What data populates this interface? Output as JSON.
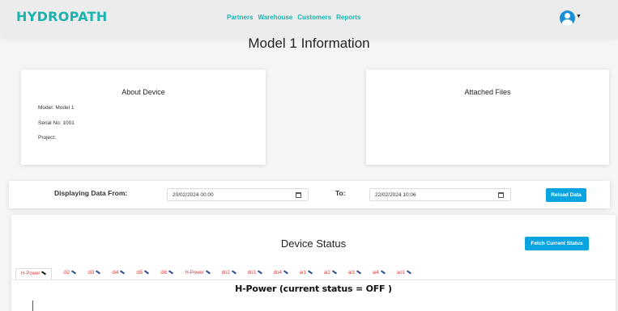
{
  "app": {
    "brand": "HYDROPATH"
  },
  "nav": {
    "items": [
      "Partners",
      "Warehouse",
      "Customers",
      "Reports"
    ]
  },
  "header": {
    "title": "Model 1 Information"
  },
  "about": {
    "title": "About Device",
    "model": "Model: Model 1",
    "serial": "Serial No: 1001",
    "project": "Project:"
  },
  "files": {
    "title": "Attached Files"
  },
  "range": {
    "from_label": "Displaying Data From:",
    "from_value": "20/02/2024 00:00",
    "to_label": "To:",
    "to_value": "22/02/2024 10:06",
    "reload_label": "Reload Data"
  },
  "status": {
    "title": "Device Status",
    "fetch_label": "Fetch Current Status",
    "tabs": [
      "H-Power",
      "di2",
      "di3",
      "di4",
      "di5",
      "di6",
      "H-Power",
      "do2",
      "do3",
      "do4",
      "ai1",
      "ai2",
      "ai3",
      "ai4",
      "ao1"
    ],
    "active_tab": "H-Power",
    "chart_title": "H-Power (current status = OFF )"
  },
  "icons": [
    "user-avatar-icon",
    "chevron-down-icon",
    "calendar-icon",
    "edit-pencil-icon"
  ],
  "colors": {
    "brand": "#19b3b0",
    "button": "#0aa5e0",
    "tab_text": "#e23a3a",
    "avatar": "#1a8fd6"
  }
}
